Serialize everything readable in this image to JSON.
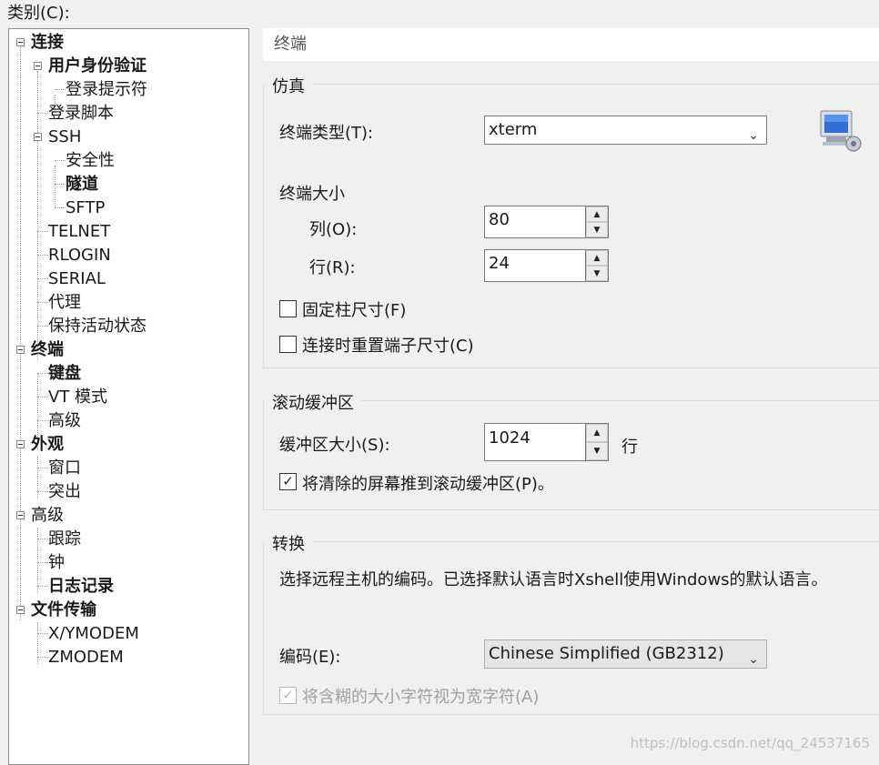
{
  "category_label": "类别(C):",
  "tree": {
    "nodes": [
      {
        "label": "连接",
        "bold": true
      },
      {
        "label": "用户身份验证",
        "bold": true
      },
      {
        "label": "登录提示符",
        "bold": false
      },
      {
        "label": "登录脚本",
        "bold": false
      },
      {
        "label": "SSH",
        "bold": false
      },
      {
        "label": "安全性",
        "bold": false
      },
      {
        "label": "隧道",
        "bold": true
      },
      {
        "label": "SFTP",
        "bold": false
      },
      {
        "label": "TELNET",
        "bold": false
      },
      {
        "label": "RLOGIN",
        "bold": false
      },
      {
        "label": "SERIAL",
        "bold": false
      },
      {
        "label": "代理",
        "bold": false
      },
      {
        "label": "保持活动状态",
        "bold": false
      },
      {
        "label": "终端",
        "bold": true
      },
      {
        "label": "键盘",
        "bold": true
      },
      {
        "label": "VT 模式",
        "bold": false
      },
      {
        "label": "高级",
        "bold": false
      },
      {
        "label": "外观",
        "bold": true
      },
      {
        "label": "窗口",
        "bold": false
      },
      {
        "label": "突出",
        "bold": false
      },
      {
        "label": "高级",
        "bold": false
      },
      {
        "label": "跟踪",
        "bold": false
      },
      {
        "label": "钟",
        "bold": false
      },
      {
        "label": "日志记录",
        "bold": true
      },
      {
        "label": "文件传输",
        "bold": true
      },
      {
        "label": "X/YMODEM",
        "bold": false
      },
      {
        "label": "ZMODEM",
        "bold": false
      }
    ]
  },
  "page_title": "终端",
  "emulation": {
    "section": "仿真",
    "terminal_type_label": "终端类型(T):",
    "terminal_type_value": "xterm",
    "size_label": "终端大小",
    "columns_label": "列(O):",
    "columns_value": "80",
    "rows_label": "行(R):",
    "rows_value": "24",
    "fixed_size_label": "固定柱尺寸(F)",
    "fixed_size_checked": "",
    "reset_on_connect_label": "连接时重置端子尺寸(C)",
    "reset_on_connect_checked": ""
  },
  "scroll": {
    "section": "滚动缓冲区",
    "buffer_label": "缓冲区大小(S):",
    "buffer_value": "1024",
    "buffer_unit": "行",
    "push_label": "将清除的屏幕推到滚动缓冲区(P)。",
    "push_checked": "✓"
  },
  "translation": {
    "section": "转换",
    "description": "选择远程主机的编码。已选择默认语言时Xshell使用Windows的默认语言。",
    "encoding_label": "编码(E):",
    "encoding_value": "Chinese Simplified (GB2312)",
    "ambiguous_label": "将含糊的大小字符视为宽字符(A)",
    "ambiguous_checked": "✓"
  },
  "watermark": "https://blog.csdn.net/qq_24537165"
}
